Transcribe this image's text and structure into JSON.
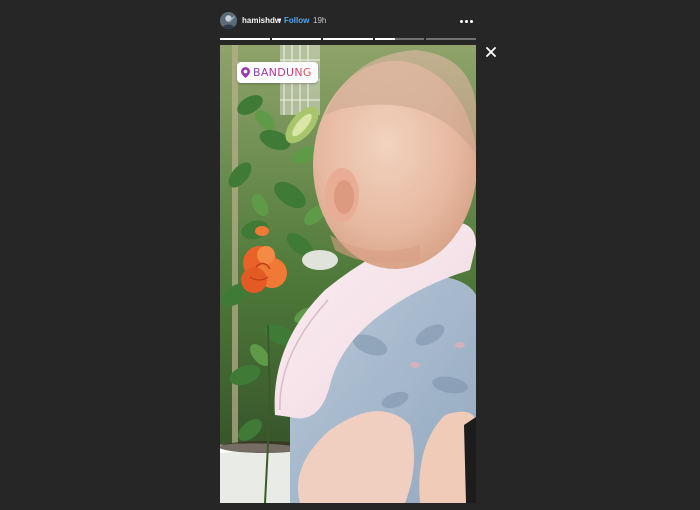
{
  "header": {
    "username": "hamishdw",
    "separator": "•",
    "follow_label": "Follow",
    "timestamp": "19h",
    "more_icon": "more-horizontal-icon",
    "avatar_icon": "avatar"
  },
  "progress": {
    "segments": [
      1,
      1,
      1,
      0.4,
      0
    ],
    "current_index": 3
  },
  "close": {
    "icon": "close-icon"
  },
  "story": {
    "location_sticker": {
      "label": "BANDUNG",
      "icon": "location-pin-icon"
    }
  },
  "colors": {
    "background": "#262626",
    "follow": "#4fa8f5",
    "sticker_gradient_start": "#8a3ab9",
    "sticker_gradient_end": "#e95950"
  }
}
